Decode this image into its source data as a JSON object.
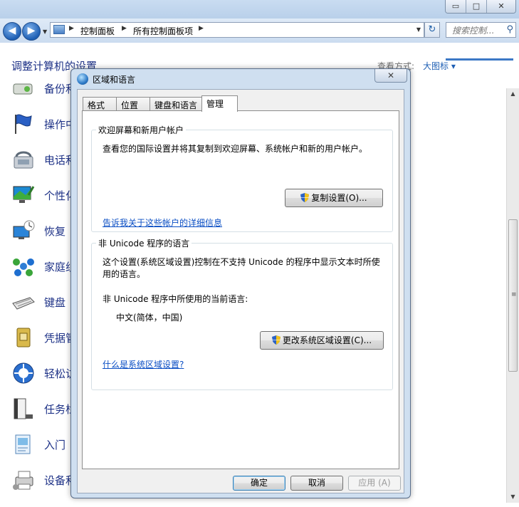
{
  "window": {
    "title_buttons": {
      "minimize": "▭",
      "maximize": "□",
      "close": "✕"
    }
  },
  "nav": {
    "back_glyph": "◀",
    "forward_glyph": "▶",
    "breadcrumbs": [
      "控制面板",
      "所有控制面板项"
    ],
    "refresh_glyph": "↻",
    "search_placeholder": "搜索控制...",
    "search_icon": "search-icon"
  },
  "page": {
    "heading": "调整计算机的设置",
    "view_mode_label": "查看方式:",
    "view_mode_value": "大图标 ▾"
  },
  "items": [
    {
      "label": "备份和",
      "icon": "backup-icon"
    },
    {
      "label": "操作中",
      "icon": "action-center-flag-icon"
    },
    {
      "label": "电话和",
      "icon": "phone-modem-icon"
    },
    {
      "label": "个性化",
      "icon": "personalization-icon"
    },
    {
      "label": "恢复",
      "icon": "recovery-icon"
    },
    {
      "label": "家庭组",
      "icon": "homegroup-icon"
    },
    {
      "label": "键盘",
      "icon": "keyboard-icon"
    },
    {
      "label": "凭据管",
      "icon": "credential-manager-icon"
    },
    {
      "label": "轻松访",
      "icon": "ease-of-access-icon"
    },
    {
      "label": "任务栏",
      "icon": "taskbar-icon"
    },
    {
      "label": "入门",
      "icon": "getting-started-icon"
    },
    {
      "label": "设备和",
      "icon": "devices-printers-icon"
    }
  ],
  "dialog": {
    "title": "区域和语言",
    "close_glyph": "✕",
    "tabs": [
      "格式",
      "位置",
      "键盘和语言",
      "管理"
    ],
    "active_tab": "管理",
    "welcome_group": {
      "title": "欢迎屏幕和新用户帐户",
      "description": "查看您的国际设置并将其复制到欢迎屏幕、系统帐户和新的用户帐户。",
      "copy_button": "复制设置(O)...",
      "link": "告诉我关于这些帐户的详细信息"
    },
    "unicode_group": {
      "title": "非 Unicode 程序的语言",
      "description_line1": "这个设置(系统区域设置)控制在不支持 Unicode 的程序中显示文本时所使",
      "description_line2": "用的语言。",
      "current_label": "非 Unicode 程序中所使用的当前语言:",
      "current_value": "中文(简体，中国)",
      "change_button": "更改系统区域设置(C)...",
      "link": "什么是系统区域设置?"
    },
    "ok_button": "确定",
    "cancel_button": "取消",
    "apply_button": "应用 (A)"
  },
  "colors": {
    "link": "#0a4ec4",
    "heading": "#1e3287",
    "accent": "#3b78c6"
  }
}
